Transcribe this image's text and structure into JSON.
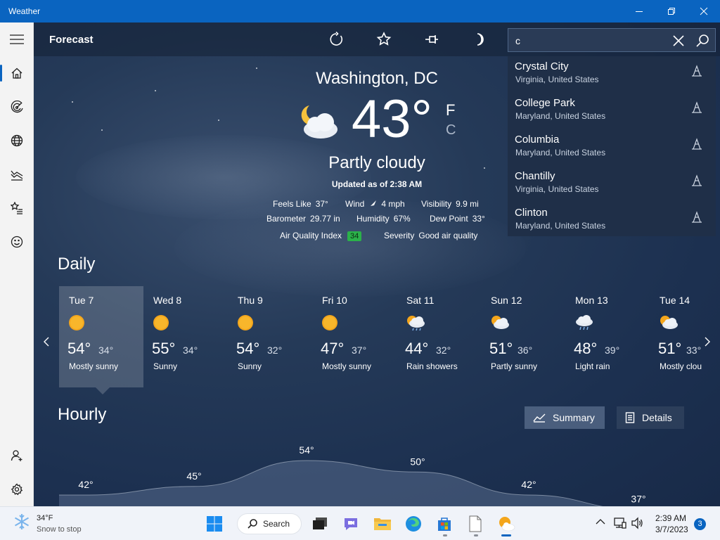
{
  "window": {
    "title": "Weather"
  },
  "header": {
    "page_title": "Forecast"
  },
  "search": {
    "value": "c",
    "suggestions": [
      {
        "city": "Crystal City",
        "region": "Virginia, United States"
      },
      {
        "city": "College Park",
        "region": "Maryland, United States"
      },
      {
        "city": "Columbia",
        "region": "Maryland, United States"
      },
      {
        "city": "Chantilly",
        "region": "Virginia, United States"
      },
      {
        "city": "Clinton",
        "region": "Maryland, United States"
      }
    ]
  },
  "current": {
    "location": "Washington, DC",
    "temp": "43°",
    "unit_f": "F",
    "unit_c": "C",
    "condition": "Partly cloudy",
    "updated": "Updated as of 2:38 AM",
    "feels_like_label": "Feels Like",
    "feels_like": "37°",
    "wind_label": "Wind",
    "wind": "4 mph",
    "visibility_label": "Visibility",
    "visibility": "9.9 mi",
    "barometer_label": "Barometer",
    "barometer": "29.77 in",
    "humidity_label": "Humidity",
    "humidity": "67%",
    "dew_point_label": "Dew Point",
    "dew_point": "33°",
    "aqi_label": "Air Quality Index",
    "aqi": "34",
    "severity_label": "Severity",
    "severity": "Good air quality"
  },
  "daily": {
    "title": "Daily",
    "days": [
      {
        "name": "Tue 7",
        "hi": "54°",
        "lo": "34°",
        "cond": "Mostly sunny",
        "icon": "sun-icon"
      },
      {
        "name": "Wed 8",
        "hi": "55°",
        "lo": "34°",
        "cond": "Sunny",
        "icon": "sun-icon"
      },
      {
        "name": "Thu 9",
        "hi": "54°",
        "lo": "32°",
        "cond": "Sunny",
        "icon": "sun-icon"
      },
      {
        "name": "Fri 10",
        "hi": "47°",
        "lo": "37°",
        "cond": "Mostly sunny",
        "icon": "sun-icon"
      },
      {
        "name": "Sat 11",
        "hi": "44°",
        "lo": "32°",
        "cond": "Rain showers",
        "icon": "sun-rain-cloud-icon"
      },
      {
        "name": "Sun 12",
        "hi": "51°",
        "lo": "36°",
        "cond": "Partly sunny",
        "icon": "partly-sunny-icon"
      },
      {
        "name": "Mon 13",
        "hi": "48°",
        "lo": "39°",
        "cond": "Light rain",
        "icon": "rain-cloud-icon"
      },
      {
        "name": "Tue 14",
        "hi": "51°",
        "lo": "33°",
        "cond": "Mostly cloudy",
        "icon": "partly-sunny-icon"
      }
    ]
  },
  "hourly": {
    "title": "Hourly",
    "summary_label": "Summary",
    "details_label": "Details",
    "chart_data": {
      "type": "area",
      "series": [
        {
          "values": [
            42,
            45,
            54,
            50,
            42,
            37
          ]
        }
      ],
      "labels": [
        "42°",
        "45°",
        "54°",
        "50°",
        "42°",
        "37°"
      ]
    }
  },
  "taskbar": {
    "weather_temp": "34°F",
    "weather_desc": "Snow to stop",
    "search_label": "Search",
    "time": "2:39 AM",
    "date": "3/7/2023",
    "notifications": "3"
  },
  "colors": {
    "accent": "#0a64c0",
    "aqi_good": "#2bb14a"
  }
}
